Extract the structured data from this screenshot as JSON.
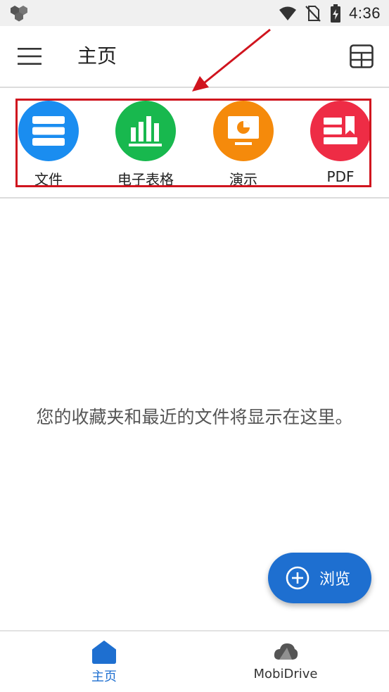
{
  "status_bar": {
    "time": "4:36",
    "icons": [
      "app-hex-icon",
      "wifi-icon",
      "no-sim-icon",
      "battery-charging-icon"
    ]
  },
  "app_bar": {
    "title": "主页",
    "menu_icon": "hamburger-menu-icon",
    "view_toggle_icon": "grid-view-icon"
  },
  "quick_access": {
    "items": [
      {
        "label": "文件",
        "icon": "document-icon",
        "color": "#1a8df0"
      },
      {
        "label": "电子表格",
        "icon": "spreadsheet-chart-icon",
        "color": "#18b84e"
      },
      {
        "label": "演示",
        "icon": "presentation-icon",
        "color": "#f58a0b"
      },
      {
        "label": "PDF",
        "icon": "pdf-icon",
        "color": "#ee2c45"
      }
    ]
  },
  "empty_state": {
    "message": "您的收藏夹和最近的文件将显示在这里。"
  },
  "fab": {
    "label": "浏览",
    "icon": "plus-circle-icon",
    "color": "#1e6fd0"
  },
  "bottom_nav": {
    "items": [
      {
        "label": "主页",
        "icon": "home-icon",
        "active": true,
        "color": "#1e6fd0"
      },
      {
        "label": "MobiDrive",
        "icon": "cloud-drive-icon",
        "active": false,
        "color": "#333333"
      }
    ]
  },
  "annotation": {
    "highlight_color": "#d0141e"
  }
}
